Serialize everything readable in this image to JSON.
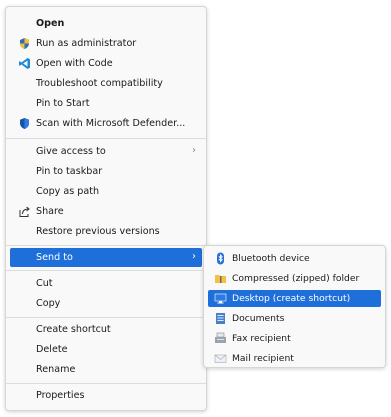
{
  "context_menu": {
    "items": [
      {
        "label": "Open",
        "icon": "none"
      },
      {
        "label": "Run as administrator",
        "icon": "shield-icon"
      },
      {
        "label": "Open with Code",
        "icon": "vscode-icon"
      },
      {
        "label": "Troubleshoot compatibility",
        "icon": "none"
      },
      {
        "label": "Pin to Start",
        "icon": "none"
      },
      {
        "label": "Scan with Microsoft Defender...",
        "icon": "defender-shield-icon"
      },
      {
        "label": "Give access to",
        "icon": "none",
        "has_submenu": true
      },
      {
        "label": "Pin to taskbar",
        "icon": "none"
      },
      {
        "label": "Copy as path",
        "icon": "none"
      },
      {
        "label": "Share",
        "icon": "share-icon"
      },
      {
        "label": "Restore previous versions",
        "icon": "none"
      },
      {
        "label": "Send to",
        "icon": "none",
        "has_submenu": true,
        "highlighted": true
      },
      {
        "label": "Cut",
        "icon": "none"
      },
      {
        "label": "Copy",
        "icon": "none"
      },
      {
        "label": "Create shortcut",
        "icon": "none"
      },
      {
        "label": "Delete",
        "icon": "none"
      },
      {
        "label": "Rename",
        "icon": "none"
      },
      {
        "label": "Properties",
        "icon": "none"
      }
    ],
    "submenu_arrow": "›"
  },
  "send_to_submenu": {
    "items": [
      {
        "label": "Bluetooth device",
        "icon": "bluetooth-icon"
      },
      {
        "label": "Compressed (zipped) folder",
        "icon": "zip-folder-icon"
      },
      {
        "label": "Desktop (create shortcut)",
        "icon": "desktop-icon",
        "highlighted": true
      },
      {
        "label": "Documents",
        "icon": "documents-icon"
      },
      {
        "label": "Fax recipient",
        "icon": "fax-icon"
      },
      {
        "label": "Mail recipient",
        "icon": "mail-icon"
      }
    ]
  },
  "colors": {
    "highlight": "#1e6fd9",
    "menu_background": "#f9f9f9",
    "separator": "#dcdcdc"
  }
}
